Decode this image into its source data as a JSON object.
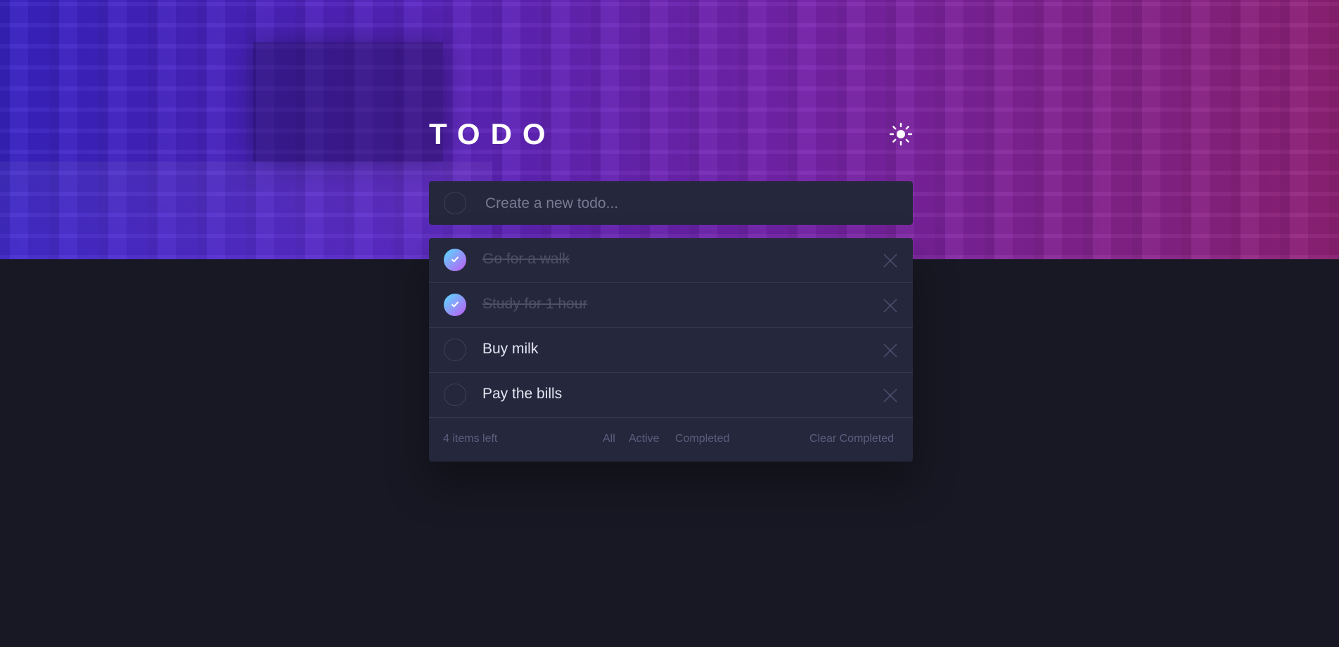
{
  "app": {
    "title": "TODO",
    "theme_icon": "sun-icon"
  },
  "new_todo": {
    "placeholder": "Create a new todo..."
  },
  "todos": [
    {
      "text": "Go for a walk",
      "completed": true
    },
    {
      "text": "Study for 1 hour",
      "completed": true
    },
    {
      "text": "Buy milk",
      "completed": false
    },
    {
      "text": "Pay the bills",
      "completed": false
    }
  ],
  "footer": {
    "items_left": "4 items left",
    "filter_all": "All",
    "filter_active": "Active",
    "filter_completed": "Completed",
    "clear_completed": "Clear Completed"
  },
  "colors": {
    "background": "#181824",
    "card": "#25273c",
    "check_gradient_start": "#57ddff",
    "check_gradient_end": "#c058f3",
    "hero_start": "#3a24c8",
    "hero_end": "#94237a"
  }
}
